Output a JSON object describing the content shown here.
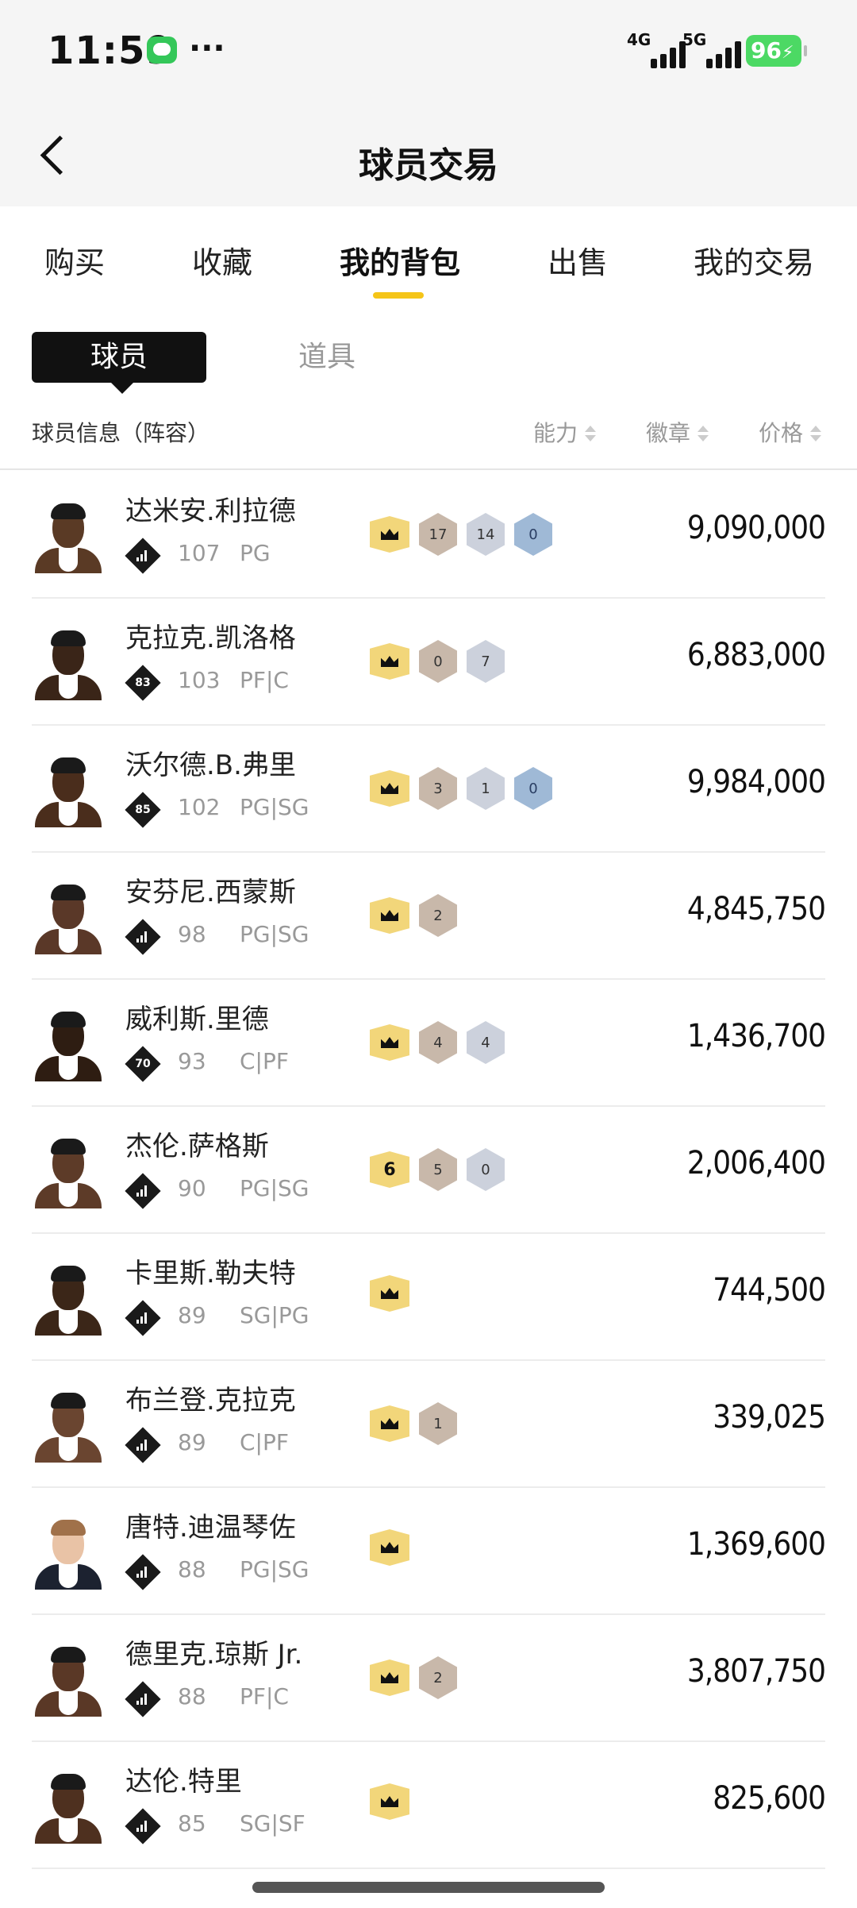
{
  "status_bar": {
    "time": "11:59",
    "more": "···",
    "net1": "4G",
    "net2": "5G",
    "battery": "96"
  },
  "header": {
    "title": "球员交易"
  },
  "tabs": [
    {
      "label": "购买"
    },
    {
      "label": "收藏"
    },
    {
      "label": "我的背包"
    },
    {
      "label": "出售"
    },
    {
      "label": "我的交易"
    }
  ],
  "subtabs": {
    "player": "球员",
    "item": "道具"
  },
  "columns": {
    "info": "球员信息（阵容）",
    "ability": "能力",
    "badge": "徽章",
    "price": "价格"
  },
  "players": [
    {
      "name": "达米安.利拉德",
      "rating_badge": "",
      "overall": "107",
      "position": "PG",
      "crown": "",
      "badges": [
        {
          "v": "17",
          "t": "bronze"
        },
        {
          "v": "14",
          "t": "silver"
        },
        {
          "v": "0",
          "t": "blue"
        }
      ],
      "price": "9,090,000",
      "skin": "#5a3a25"
    },
    {
      "name": "克拉克.凯洛格",
      "rating_badge": "83",
      "overall": "103",
      "position": "PF|C",
      "crown": "",
      "badges": [
        {
          "v": "0",
          "t": "bronze"
        },
        {
          "v": "7",
          "t": "silver"
        }
      ],
      "price": "6,883,000",
      "skin": "#3a2518"
    },
    {
      "name": "沃尔德.B.弗里",
      "rating_badge": "85",
      "overall": "102",
      "position": "PG|SG",
      "crown": "",
      "badges": [
        {
          "v": "3",
          "t": "bronze"
        },
        {
          "v": "1",
          "t": "silver"
        },
        {
          "v": "0",
          "t": "blue"
        }
      ],
      "price": "9,984,000",
      "skin": "#4a2d1c"
    },
    {
      "name": "安芬尼.西蒙斯",
      "rating_badge": "",
      "overall": "98",
      "position": "PG|SG",
      "crown": "",
      "badges": [
        {
          "v": "2",
          "t": "bronze"
        }
      ],
      "price": "4,845,750",
      "skin": "#5a3828"
    },
    {
      "name": "威利斯.里德",
      "rating_badge": "70",
      "overall": "93",
      "position": "C|PF",
      "crown": "",
      "badges": [
        {
          "v": "4",
          "t": "bronze"
        },
        {
          "v": "4",
          "t": "silver"
        }
      ],
      "price": "1,436,700",
      "skin": "#2e1d12"
    },
    {
      "name": "杰伦.萨格斯",
      "rating_badge": "",
      "overall": "90",
      "position": "PG|SG",
      "crown": "6",
      "badges": [
        {
          "v": "5",
          "t": "bronze"
        },
        {
          "v": "0",
          "t": "silver"
        }
      ],
      "price": "2,006,400",
      "skin": "#5d3b28"
    },
    {
      "name": "卡里斯.勒夫特",
      "rating_badge": "",
      "overall": "89",
      "position": "SG|PG",
      "crown": "",
      "badges": [],
      "price": "744,500",
      "skin": "#3b2618"
    },
    {
      "name": "布兰登.克拉克",
      "rating_badge": "",
      "overall": "89",
      "position": "C|PF",
      "crown": "",
      "badges": [
        {
          "v": "1",
          "t": "bronze"
        }
      ],
      "price": "339,025",
      "skin": "#6a4530"
    },
    {
      "name": "唐特.迪温琴佐",
      "rating_badge": "",
      "overall": "88",
      "position": "PG|SG",
      "crown": "",
      "badges": [],
      "price": "1,369,600",
      "skin": "#e9c3a6"
    },
    {
      "name": "德里克.琼斯 Jr.",
      "rating_badge": "",
      "overall": "88",
      "position": "PF|C",
      "crown": "",
      "badges": [
        {
          "v": "2",
          "t": "bronze"
        }
      ],
      "price": "3,807,750",
      "skin": "#5a3826"
    },
    {
      "name": "达伦.特里",
      "rating_badge": "",
      "overall": "85",
      "position": "SG|SF",
      "crown": "",
      "badges": [],
      "price": "825,600",
      "skin": "#4e301f"
    }
  ]
}
